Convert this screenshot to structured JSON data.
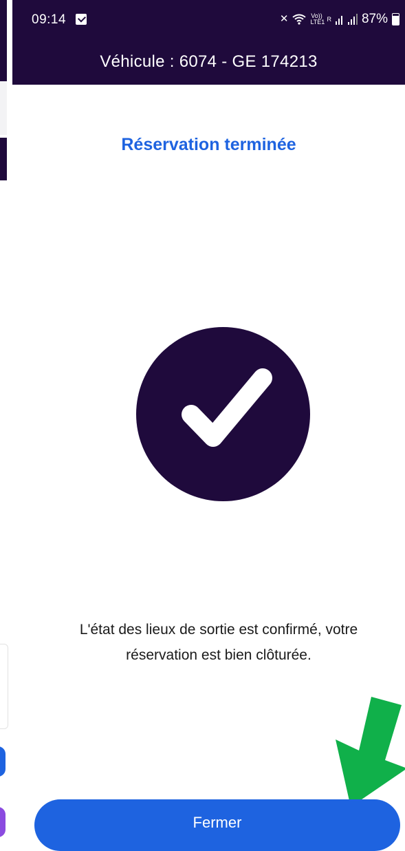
{
  "status_bar": {
    "time": "09:14",
    "volte_label": "Vo)) LTE1",
    "roaming_label": "R",
    "battery_percent": "87%"
  },
  "header": {
    "vehicle_title": "Véhicule : 6074 - GE 174213"
  },
  "main": {
    "title": "Réservation terminée",
    "confirmation_icon": "check-icon",
    "message_line1": "L'état des lieux de sortie est confirmé, votre",
    "message_line2": "réservation est bien clôturée."
  },
  "footer": {
    "close_label": "Fermer"
  },
  "colors": {
    "header_background": "#1f0a3c",
    "accent": "#1e63e0",
    "hint_arrow": "#10b04a"
  }
}
